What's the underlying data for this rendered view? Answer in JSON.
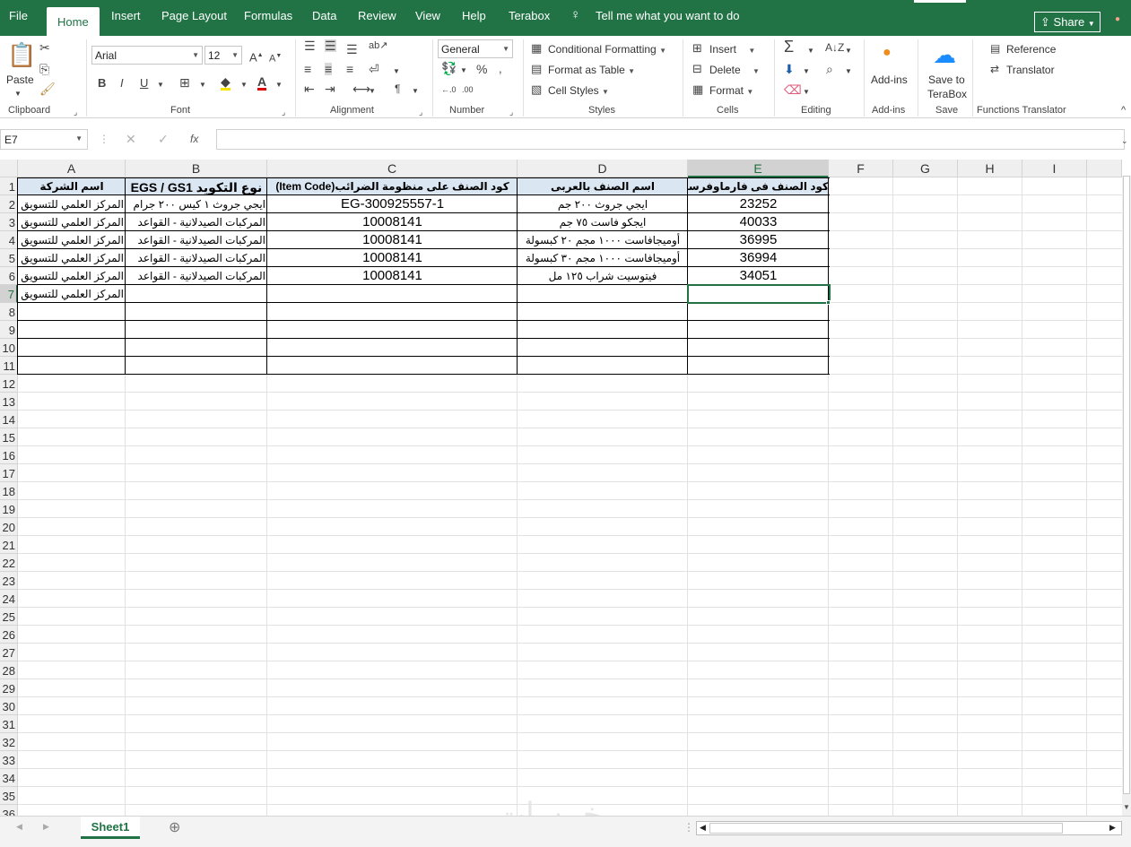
{
  "tabs": {
    "file": "File",
    "home": "Home",
    "insert": "Insert",
    "page_layout": "Page Layout",
    "formulas": "Formulas",
    "data": "Data",
    "review": "Review",
    "view": "View",
    "help": "Help",
    "terabox": "Terabox"
  },
  "tell_me": "Tell me what you want to do",
  "share": "Share",
  "ribbon": {
    "clipboard": {
      "paste": "Paste",
      "label": "Clipboard"
    },
    "font": {
      "name": "Arial",
      "size": "12",
      "label": "Font"
    },
    "alignment": {
      "label": "Alignment"
    },
    "number": {
      "format": "General",
      "label": "Number"
    },
    "styles": {
      "conditional": "Conditional Formatting",
      "format_table": "Format as Table",
      "cell_styles": "Cell Styles",
      "label": "Styles"
    },
    "cells": {
      "insert": "Insert",
      "delete": "Delete",
      "format": "Format",
      "label": "Cells"
    },
    "editing": {
      "label": "Editing"
    },
    "addins": {
      "button": "Add-ins",
      "label": "Add-ins"
    },
    "save": {
      "button_line1": "Save to",
      "button_line2": "TeraBox",
      "label": "Save"
    },
    "functions": {
      "reference": "Reference",
      "translator": "Translator",
      "label": "Functions Translator"
    }
  },
  "formula_bar": {
    "name_box": "E7",
    "content": ""
  },
  "columns": [
    "A",
    "B",
    "C",
    "D",
    "E",
    "F",
    "G",
    "H",
    "I"
  ],
  "rows": [
    "1",
    "2",
    "3",
    "4",
    "5",
    "6",
    "7",
    "8",
    "9",
    "10",
    "11",
    "12",
    "13",
    "14",
    "15",
    "16",
    "17",
    "18",
    "19",
    "20",
    "21",
    "22",
    "23",
    "24",
    "25",
    "26",
    "27",
    "28",
    "29",
    "30",
    "31",
    "32",
    "33",
    "34",
    "35",
    "36"
  ],
  "table": {
    "headers": {
      "a": "اسم الشركة",
      "b": "نوع التكويد EGS / GS1",
      "c": "كود الصنف على منظومة الضرائب(Item Code)",
      "d": "اسم الصنف بالعربى",
      "e": "كود الصنف فى فارماوفرسيز"
    },
    "rows": [
      {
        "a": "المركز العلمي للتسويق",
        "b": "ايجي جروث ١ كيس ٢٠٠ جرام",
        "c": "EG-300925557-1",
        "d": "ايجي جروث ٢٠٠ جم",
        "e": "23252"
      },
      {
        "a": "المركز العلمي للتسويق",
        "b": "المركبات الصيدلانية - القواعد",
        "c": "10008141",
        "d": "ايجكو فاست ٧٥ جم",
        "e": "40033"
      },
      {
        "a": "المركز العلمي للتسويق",
        "b": "المركبات الصيدلانية - القواعد",
        "c": "10008141",
        "d": "أوميجافاست ١٠٠٠ مجم ٢٠ كبسولة",
        "e": "36995"
      },
      {
        "a": "المركز العلمي للتسويق",
        "b": "المركبات الصيدلانية - القواعد",
        "c": "10008141",
        "d": "أوميجافاست ١٠٠٠ مجم ٣٠ كبسولة",
        "e": "36994"
      },
      {
        "a": "المركز العلمي للتسويق",
        "b": "المركبات الصيدلانية - القواعد",
        "c": "10008141",
        "d": "فيتوسيت شراب ١٢٥ مل",
        "e": "34051"
      },
      {
        "a": "المركز العلمي للتسويق",
        "b": "",
        "c": "",
        "d": "",
        "e": ""
      }
    ]
  },
  "sheet_tab": "Sheet1",
  "watermark": "خمسات"
}
